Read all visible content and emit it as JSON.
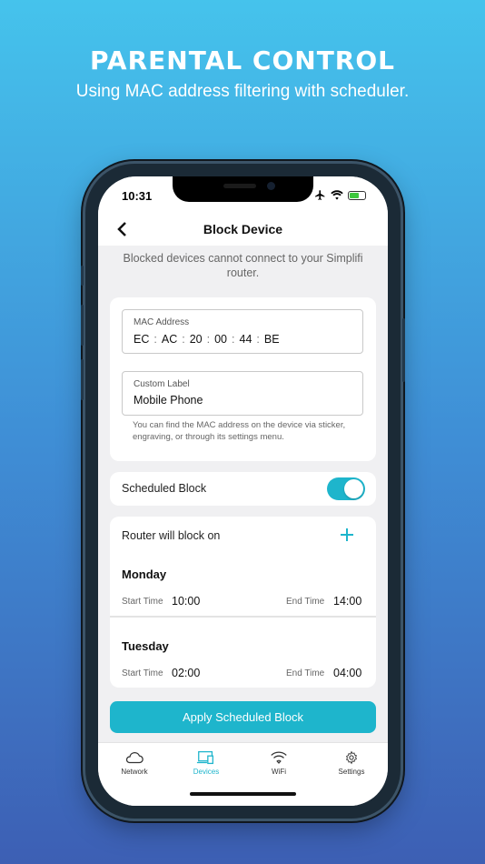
{
  "promo": {
    "title": "PARENTAL CONTROL",
    "subtitle": "Using MAC address filtering with scheduler."
  },
  "status_bar": {
    "time": "10:31",
    "icons": [
      "airplane-icon",
      "wifi-icon",
      "battery-charging-icon"
    ],
    "battery_color": "#3ec83e"
  },
  "nav": {
    "back_icon": "chevron-left-icon",
    "title": "Block Device"
  },
  "intro": "Blocked devices cannot connect to your Simplifi router.",
  "mac": {
    "label": "MAC Address",
    "segments": [
      "EC",
      "AC",
      "20",
      "00",
      "44",
      "BE"
    ],
    "separator": ":"
  },
  "custom_label": {
    "label": "Custom Label",
    "value": "Mobile Phone"
  },
  "hint": "You can find the MAC address on the device via sticker, engraving, or through its settings menu.",
  "scheduled_block": {
    "label": "Scheduled Block",
    "enabled": true
  },
  "schedule": {
    "header": "Router will block on",
    "add_icon": "plus-icon",
    "start_label": "Start Time",
    "end_label": "End Time",
    "days": [
      {
        "name": "Monday",
        "start": "10:00",
        "end": "14:00"
      },
      {
        "name": "Tuesday",
        "start": "02:00",
        "end": "04:00"
      }
    ]
  },
  "apply_button": "Apply Scheduled Block",
  "tabs": [
    {
      "label": "Network",
      "icon": "cloud-icon",
      "active": false
    },
    {
      "label": "Devices",
      "icon": "devices-icon",
      "active": true
    },
    {
      "label": "WiFi",
      "icon": "wifi-icon",
      "active": false
    },
    {
      "label": "Settings",
      "icon": "gear-icon",
      "active": false
    }
  ],
  "colors": {
    "accent": "#1eb5cc",
    "background_top": "#45c3ec",
    "background_bottom": "#3d5fb4"
  }
}
